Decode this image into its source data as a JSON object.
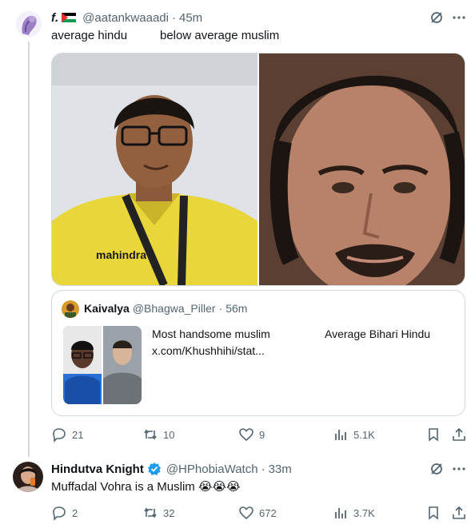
{
  "tweet1": {
    "display_name": "f.",
    "handle": "@aatankwaaadi",
    "time": "45m",
    "text_left": "average hindu",
    "text_right": "below average muslim",
    "stats": {
      "replies": "21",
      "reposts": "10",
      "likes": "9",
      "views": "5.1K"
    },
    "quote": {
      "display_name": "Kaivalya",
      "handle": "@Bhagwa_Piller",
      "time": "56m",
      "line1_left": "Most handsome muslim",
      "line1_right": "Average Bihari Hindu",
      "link": "x.com/Khushhihi/stat..."
    }
  },
  "tweet2": {
    "display_name": "Hindutva Knight",
    "handle": "@HPhobiaWatch",
    "time": "33m",
    "text": "Muffadal Vohra is a Muslim 😭😭😭",
    "stats": {
      "replies": "2",
      "reposts": "32",
      "likes": "672",
      "views": "3.7K"
    }
  },
  "colors": {
    "text": "#0f1419",
    "muted": "#536471",
    "border": "#cfd9de",
    "verified": "#1d9bf0"
  },
  "icons": [
    "grok-icon",
    "more-icon",
    "reply-icon",
    "repost-icon",
    "like-icon",
    "views-icon",
    "bookmark-icon",
    "share-icon",
    "verified-badge-icon",
    "flag-icon"
  ]
}
